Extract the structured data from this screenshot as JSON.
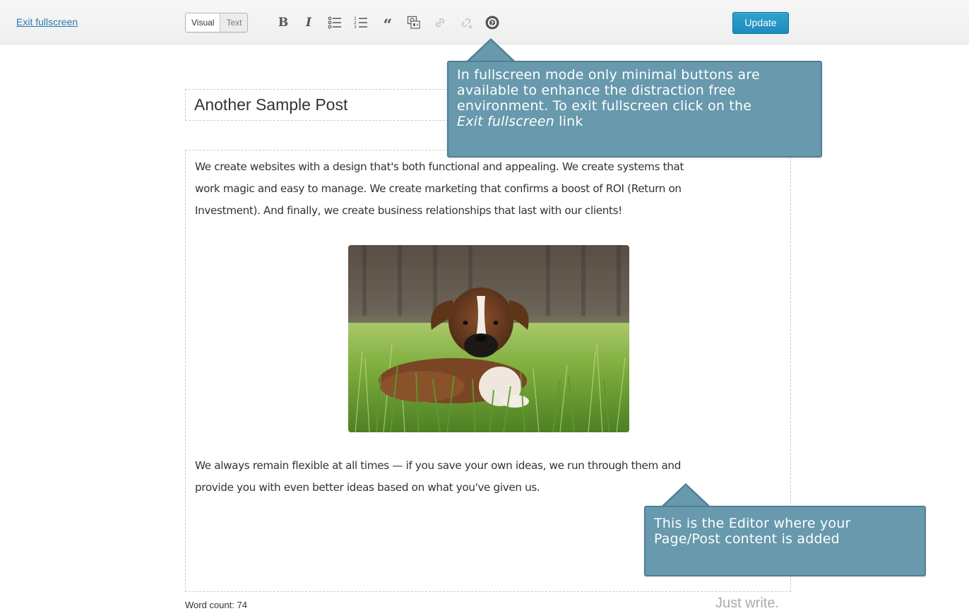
{
  "toolbar": {
    "exit_label": "Exit fullscreen",
    "tab_visual": "Visual",
    "tab_text": "Text",
    "bold_label": "B",
    "italic_label": "I",
    "quote_label": "“",
    "update_label": "Update",
    "buttons": [
      "bold-icon",
      "italic-icon",
      "bullet-list-icon",
      "numbered-list-icon",
      "blockquote-icon",
      "add-media-icon",
      "insert-link-icon",
      "remove-link-icon",
      "help-icon"
    ],
    "accent_color": "#1e8cbe"
  },
  "post": {
    "title": "Another Sample Post",
    "paragraph1_line1": "We create websites with a design that's both functional and appealing. We create systems that",
    "paragraph1_line2": "work magic and easy to manage. We create marketing that confirms a boost of ROI (Return on",
    "paragraph1_line3": "Investment). And finally, we create business relationships that last with our clients!",
    "paragraph2_line1": "We always remain flexible at all times — if you save your own ideas, we run through them and",
    "paragraph2_line2": "provide you with even better ideas based on what you've given us.",
    "image": "boxer-puppy-in-grass-photo"
  },
  "footer": {
    "word_count": "Word count: 74",
    "tagline": "Just write."
  },
  "tooltips": {
    "fullscreen_line1": "In fullscreen mode only minimal buttons are",
    "fullscreen_line2": "available to enhance the distraction free",
    "fullscreen_line3": "environment. To exit fullscreen click on the",
    "fullscreen_line4_em": "Exit fullscreen",
    "fullscreen_line4_rest": " link",
    "editor_line1": "This is the Editor where your",
    "editor_line2": "Page/Post content is added",
    "color": "#6899ad"
  }
}
